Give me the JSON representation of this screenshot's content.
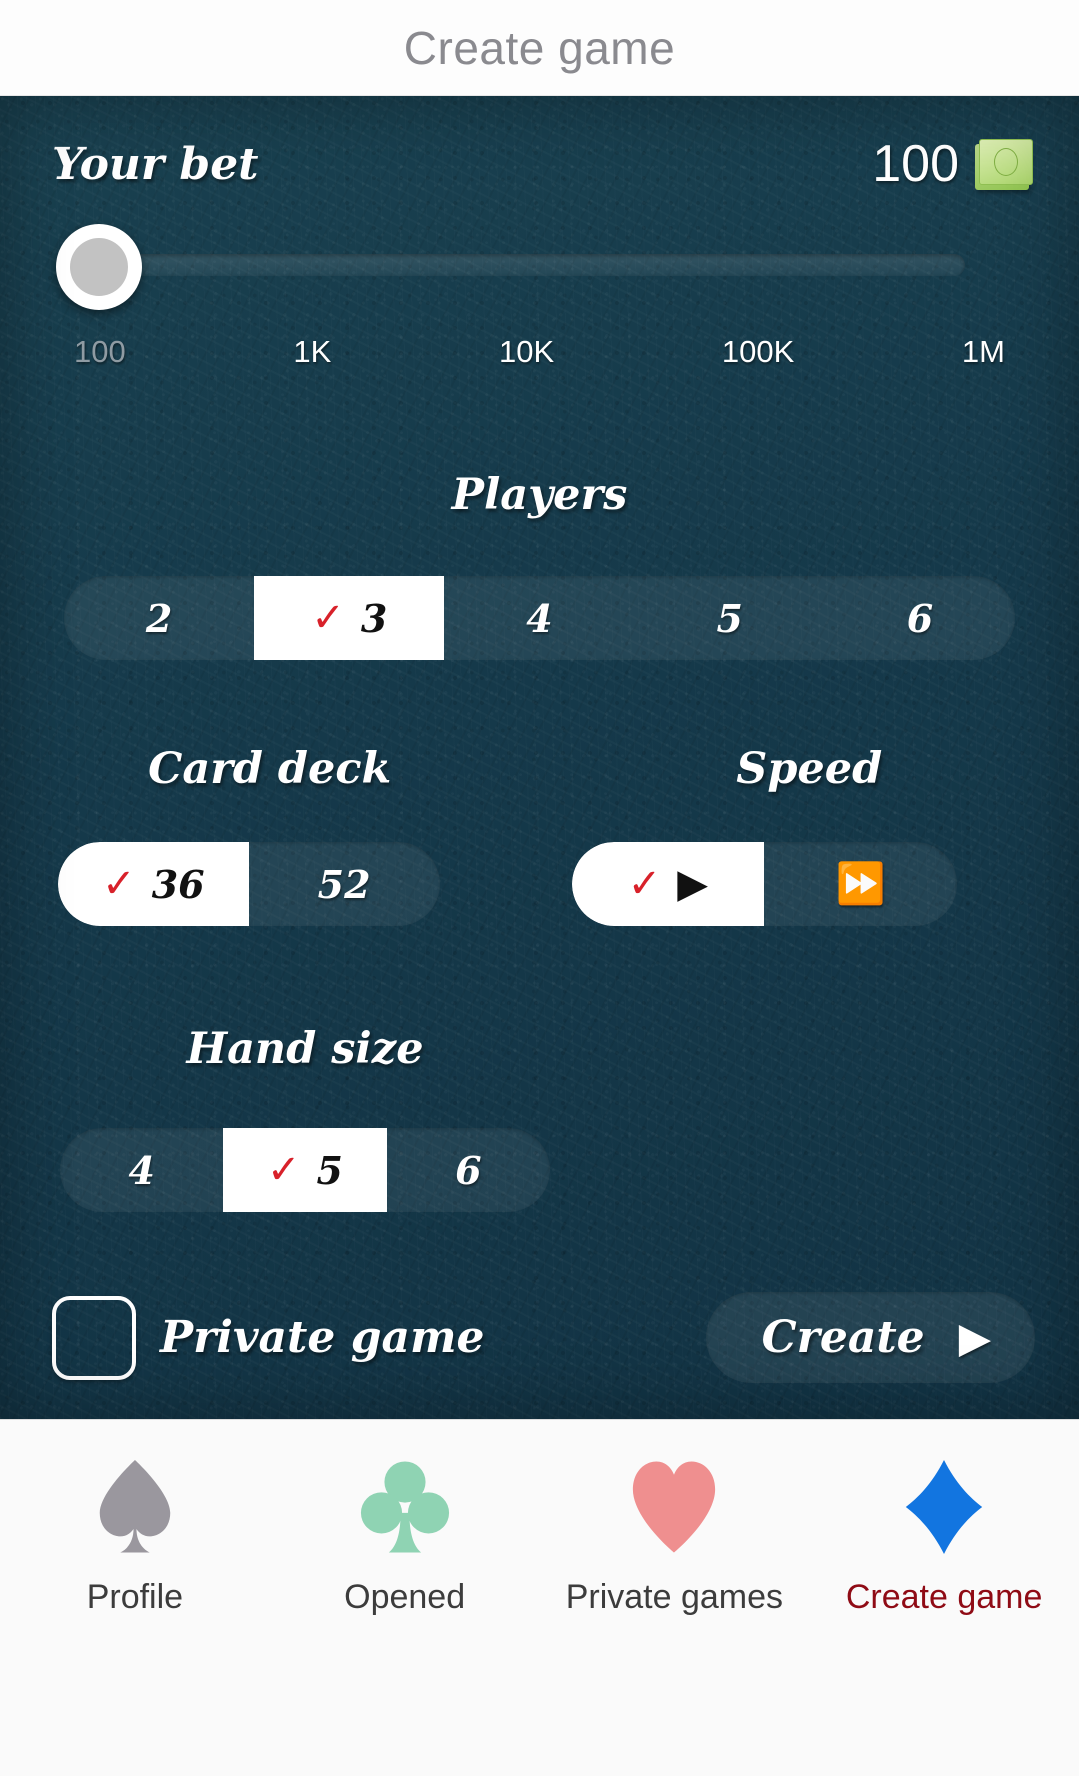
{
  "header": {
    "title": "Create game"
  },
  "bet": {
    "label": "Your bet",
    "value": "100",
    "money_icon": "money-bill-icon",
    "slider": {
      "ticks": [
        "100",
        "1K",
        "10K",
        "100K",
        "1M"
      ],
      "selected_tick_index": 0,
      "thumb_position_percent": 0
    }
  },
  "players": {
    "title": "Players",
    "options": [
      "2",
      "3",
      "4",
      "5",
      "6"
    ],
    "selected": "3",
    "selected_index": 1,
    "check_glyph": "✓"
  },
  "card_deck": {
    "title": "Card deck",
    "options": [
      "36",
      "52"
    ],
    "selected": "36",
    "selected_index": 0,
    "check_glyph": "✓"
  },
  "speed": {
    "title": "Speed",
    "options": [
      "normal-speed-icon",
      "fast-speed-icon"
    ],
    "glyphs": [
      "▶",
      "⏩"
    ],
    "selected_index": 0,
    "check_glyph": "✓"
  },
  "hand_size": {
    "title": "Hand size",
    "options": [
      "4",
      "5",
      "6"
    ],
    "selected": "5",
    "selected_index": 1,
    "check_glyph": "✓"
  },
  "private_game": {
    "label": "Private game",
    "checked": false
  },
  "create": {
    "label": "Create",
    "arrow_glyph": "▶"
  },
  "navbar": {
    "items": [
      {
        "label": "Profile",
        "icon": "spade-icon",
        "color": "#9a979e",
        "active": false
      },
      {
        "label": "Opened",
        "icon": "club-icon",
        "color": "#8fd3b3",
        "active": false
      },
      {
        "label": "Private games",
        "icon": "heart-icon",
        "color": "#ef8f8f",
        "active": false
      },
      {
        "label": "Create game",
        "icon": "diamond-icon",
        "color": "#1275e0",
        "active": true
      }
    ],
    "active_index": 3,
    "active_label_color": "#8f0b15"
  },
  "colors": {
    "board_bg": "#15394a",
    "accent_red": "#d8212a",
    "selected_bg": "#ffffff",
    "header_text": "#8a8a8f"
  }
}
